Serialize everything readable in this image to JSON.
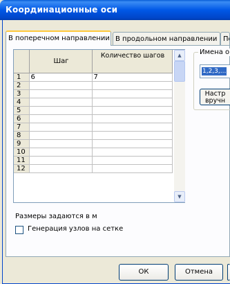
{
  "window": {
    "title": "Координационные оси"
  },
  "tabs": [
    {
      "label": "В поперечном направлении",
      "active": true
    },
    {
      "label": "В продольном направлении",
      "active": false
    },
    {
      "label": "По",
      "active": false
    }
  ],
  "grid": {
    "headers": {
      "col1": "Шаг",
      "col2": "Количество шагов"
    },
    "rows": [
      {
        "n": "1",
        "step": "6",
        "count": "7"
      },
      {
        "n": "2",
        "step": "",
        "count": ""
      },
      {
        "n": "3",
        "step": "",
        "count": ""
      },
      {
        "n": "4",
        "step": "",
        "count": ""
      },
      {
        "n": "5",
        "step": "",
        "count": ""
      },
      {
        "n": "6",
        "step": "",
        "count": ""
      },
      {
        "n": "7",
        "step": "",
        "count": ""
      },
      {
        "n": "8",
        "step": "",
        "count": ""
      },
      {
        "n": "9",
        "step": "",
        "count": ""
      },
      {
        "n": "10",
        "step": "",
        "count": ""
      },
      {
        "n": "11",
        "step": "",
        "count": ""
      },
      {
        "n": "12",
        "step": "",
        "count": ""
      }
    ]
  },
  "scroll_arrows": {
    "up": "▲",
    "down": "▼"
  },
  "names_group": {
    "label": "Имена о",
    "value": "1,2,3,..."
  },
  "set_manual_button": {
    "line1": "Настр",
    "line2": "вручн"
  },
  "units_label": "Размеры задаются в  м",
  "grid_nodes_checkbox": {
    "label": "Генерация узлов на сетке",
    "checked": false
  },
  "buttons": {
    "ok": "ОК",
    "cancel": "Отмена"
  }
}
